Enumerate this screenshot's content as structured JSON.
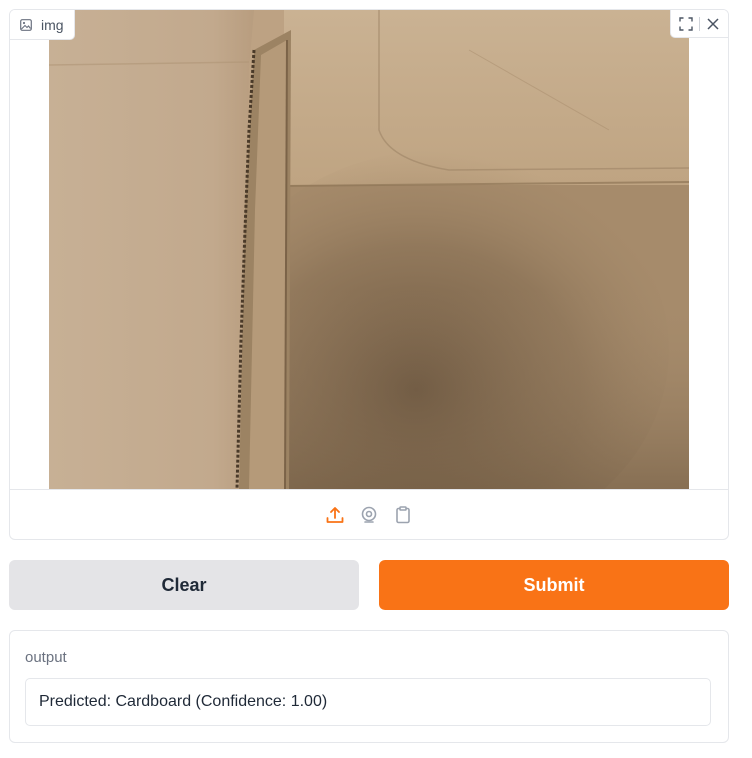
{
  "image_input": {
    "label": "img",
    "label_icon": "image-icon",
    "tools": [
      "fullscreen-icon",
      "close-icon"
    ],
    "sources": [
      "upload-icon",
      "webcam-icon",
      "clipboard-icon"
    ],
    "accent_color": "#f97316"
  },
  "buttons": {
    "clear_label": "Clear",
    "submit_label": "Submit",
    "submit_color": "#f97316"
  },
  "output": {
    "label": "output",
    "value": "Predicted: Cardboard (Confidence: 1.00)"
  }
}
